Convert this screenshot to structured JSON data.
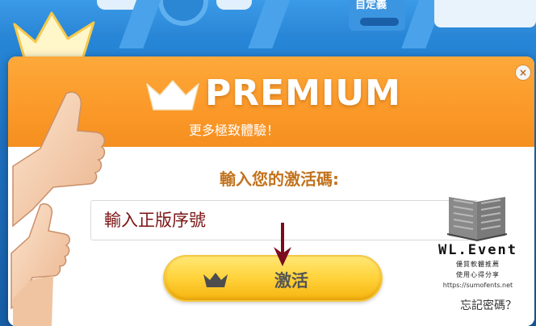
{
  "background": {
    "custom_label": "自定義"
  },
  "dialog": {
    "close_glyph": "×",
    "title": "PREMIUM",
    "subtitle": "更多極致體驗！",
    "code_label": "輸入您的激活碼:",
    "serial_value": "輸入正版序號",
    "activate_label": "激活",
    "forgot_password": "忘記密碼？"
  },
  "watermark": {
    "title": "WL.Event",
    "line1": "優質軟體推薦",
    "line2": "使用心得分享",
    "url": "https://sumofents.net"
  },
  "colors": {
    "header_orange": "#fb9a2a",
    "label_brown": "#c2731e",
    "input_text": "#7b1414",
    "button_yellow": "#ffd23a",
    "arrow": "#7a0c1e"
  },
  "icons": [
    "crown-icon",
    "close-icon",
    "book-icon",
    "thumbs-up-icon",
    "arrow-down-icon"
  ]
}
